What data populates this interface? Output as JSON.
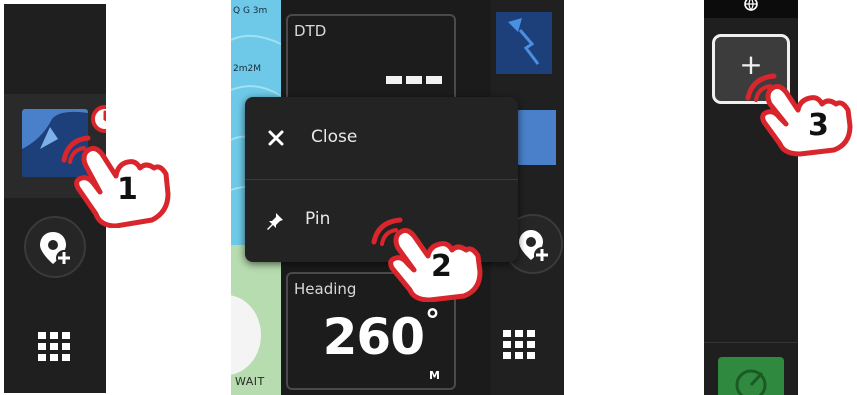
{
  "panel2": {
    "map_labels": [
      "Q G 3m",
      "2m2M"
    ],
    "map_status": "WAIT",
    "dtd_card": {
      "label": "DTD"
    },
    "heading_card": {
      "label": "Heading",
      "value": "260",
      "degree": "°",
      "unit": "M"
    },
    "menu": {
      "close_label": "Close",
      "pin_label": "Pin"
    }
  },
  "panel3": {
    "add_symbol": "+"
  },
  "steps": [
    "1",
    "2",
    "3"
  ],
  "icons": [
    "clock-icon",
    "add-waypoint-icon",
    "apps-grid-icon",
    "close-icon",
    "pin-icon",
    "plus-icon",
    "globe-icon",
    "radar-icon",
    "navigation-icon",
    "chart-icon",
    "hand-tap-icon"
  ],
  "colors": {
    "accent_red": "#d8262c",
    "chart_blue": "#4a7fc9",
    "nav_blue": "#1d3f7a",
    "radar_green": "#2f8a3f",
    "map_water": "#6ec9e8"
  }
}
